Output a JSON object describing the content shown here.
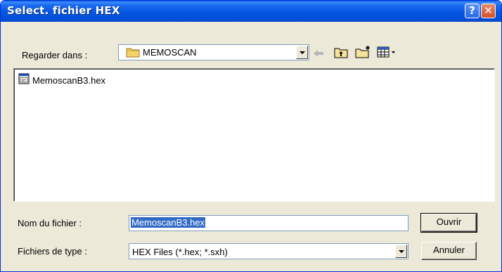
{
  "window": {
    "title": "Select. fichier HEX"
  },
  "lookin": {
    "label": "Regarder dans :",
    "value": "MEMOSCAN"
  },
  "toolbar": {
    "icons": [
      "back-arrow-icon",
      "up-folder-icon",
      "new-folder-icon",
      "view-menu-icon"
    ]
  },
  "files": [
    {
      "name": "MemoscanB3.hex",
      "icon": "hex-file-icon"
    }
  ],
  "filename": {
    "label": "Nom du fichier :",
    "value": "MemoscanB3.hex"
  },
  "filetype": {
    "label": "Fichiers de type :",
    "value": "HEX Files (*.hex; *.sxh)"
  },
  "buttons": {
    "open": "Ouvrir",
    "cancel": "Annuler"
  },
  "colors": {
    "titlebar": "#0455e0",
    "selection": "#316ac5",
    "face": "#ece9d8"
  }
}
